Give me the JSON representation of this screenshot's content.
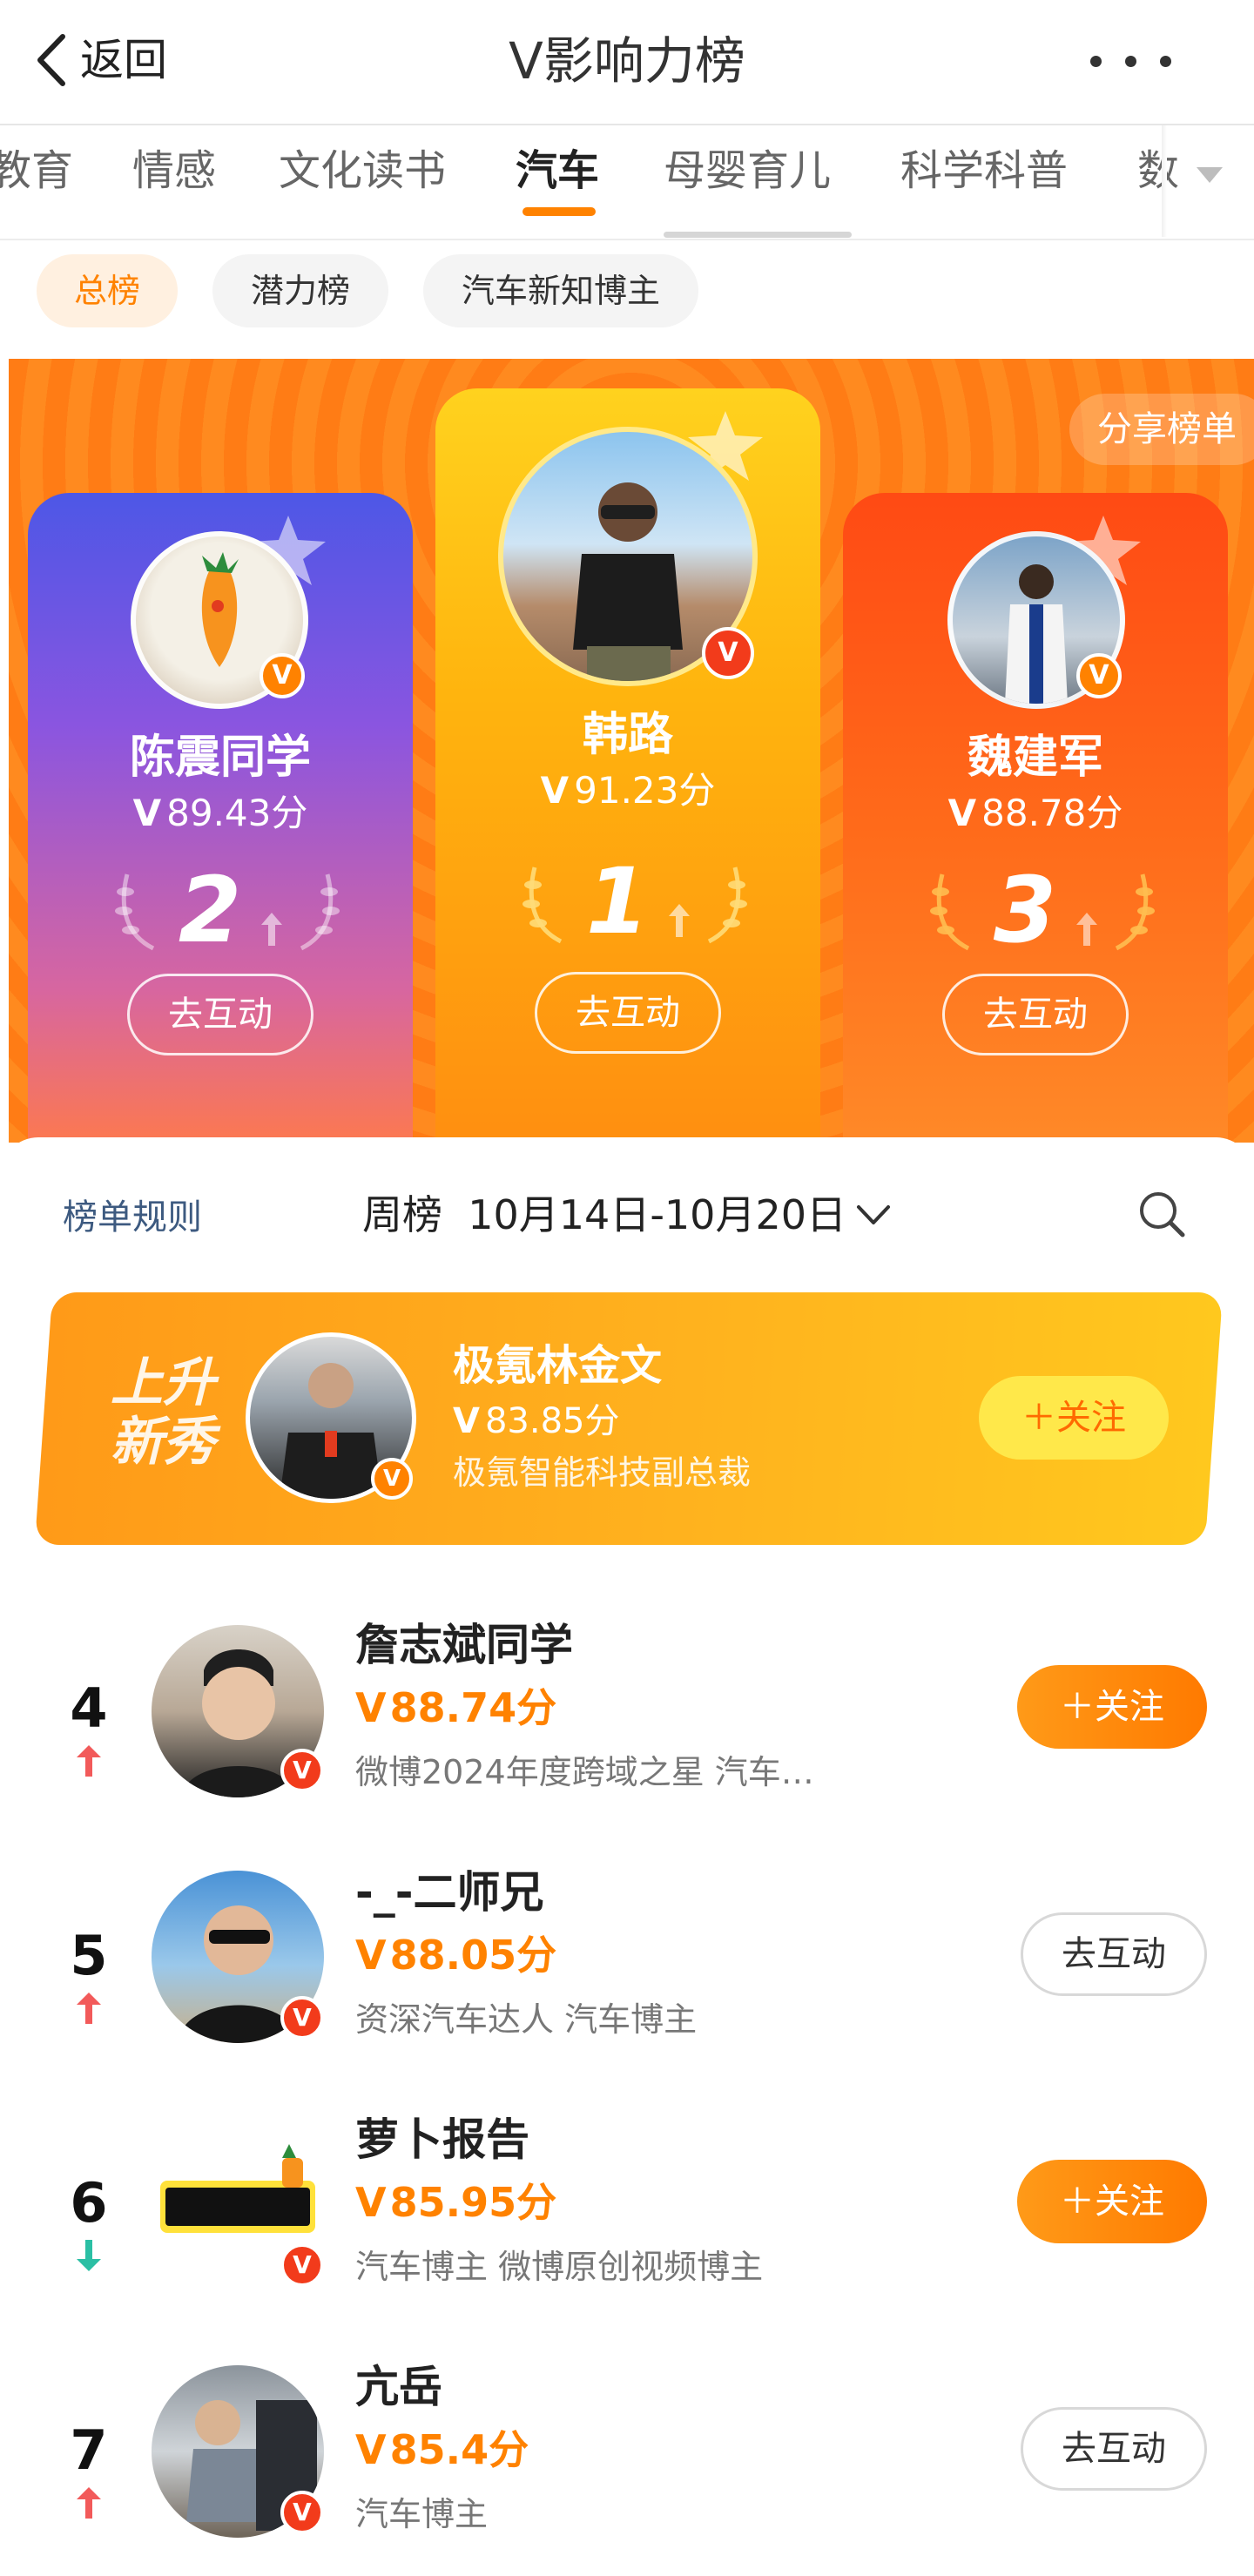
{
  "nav": {
    "back_label": "返回",
    "title": "V影响力榜"
  },
  "tabs": [
    "教育",
    "情感",
    "文化读书",
    "汽车",
    "母婴育儿",
    "科学科普",
    "数"
  ],
  "active_tab": "汽车",
  "subtabs": [
    "总榜",
    "潜力榜",
    "汽车新知博主"
  ],
  "share_label": "分享榜单",
  "top3": [
    {
      "rank": "2",
      "name": "陈震同学",
      "score": "89.43分"
    },
    {
      "rank": "1",
      "name": "韩路",
      "score": "91.23分"
    },
    {
      "rank": "3",
      "name": "魏建军",
      "score": "88.78分"
    }
  ],
  "interact_label": "去互动",
  "follow_label": "＋关注",
  "rules_label": "榜单规则",
  "period": {
    "type": "周榜",
    "range": "10月14日-10月20日"
  },
  "rising": {
    "label": "上升新秀",
    "name": "极氪林金文",
    "score": "83.85分",
    "desc": "极氪智能科技副总裁"
  },
  "list": [
    {
      "rank": "4",
      "trend": "up",
      "name": "詹志斌同学",
      "score": "88.74分",
      "desc": "微博2024年度跨域之星 汽车…",
      "action": "follow"
    },
    {
      "rank": "5",
      "trend": "up",
      "name": "-_-二师兄",
      "score": "88.05分",
      "desc": "资深汽车达人 汽车博主",
      "action": "interact"
    },
    {
      "rank": "6",
      "trend": "down",
      "name": "萝卜报告",
      "score": "85.95分",
      "desc": "汽车博主 微博原创视频博主",
      "action": "follow"
    },
    {
      "rank": "7",
      "trend": "up",
      "name": "亢岳",
      "score": "85.4分",
      "desc": "汽车博主",
      "action": "interact"
    }
  ],
  "colors": {
    "accent": "#ff8200",
    "up": "#f25a5a",
    "down": "#2bbfa4"
  }
}
